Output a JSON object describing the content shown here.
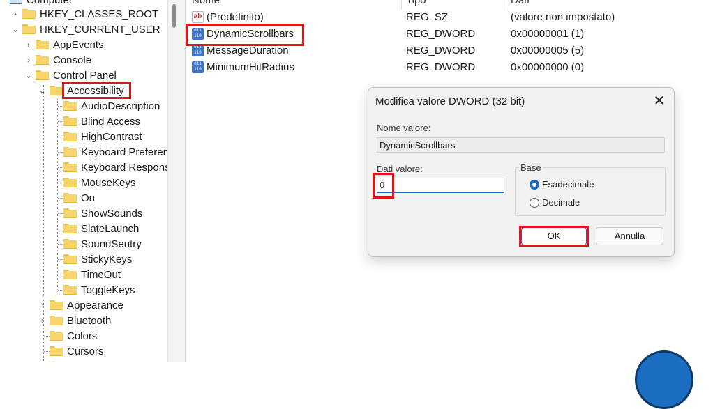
{
  "tree": {
    "items": [
      {
        "label": "Computer",
        "expander": "chevron-down"
      },
      {
        "label": "HKEY_CLASSES_ROOT",
        "expander": "chevron-right"
      },
      {
        "label": "HKEY_CURRENT_USER",
        "expander": "chevron-down"
      },
      {
        "label": "AppEvents",
        "expander": "chevron-right"
      },
      {
        "label": "Console",
        "expander": "chevron-right"
      },
      {
        "label": "Control Panel",
        "expander": "chevron-down"
      },
      {
        "label": "Accessibility",
        "expander": "chevron-down",
        "selected": true
      },
      {
        "label": "AudioDescription",
        "expander": "none"
      },
      {
        "label": "Blind Access",
        "expander": "none"
      },
      {
        "label": "HighContrast",
        "expander": "none"
      },
      {
        "label": "Keyboard Preference",
        "expander": "none"
      },
      {
        "label": "Keyboard Response",
        "expander": "none"
      },
      {
        "label": "MouseKeys",
        "expander": "none"
      },
      {
        "label": "On",
        "expander": "none"
      },
      {
        "label": "ShowSounds",
        "expander": "none"
      },
      {
        "label": "SlateLaunch",
        "expander": "none"
      },
      {
        "label": "SoundSentry",
        "expander": "none"
      },
      {
        "label": "StickyKeys",
        "expander": "none"
      },
      {
        "label": "TimeOut",
        "expander": "none"
      },
      {
        "label": "ToggleKeys",
        "expander": "none"
      },
      {
        "label": "Appearance",
        "expander": "chevron-right"
      },
      {
        "label": "Bluetooth",
        "expander": "chevron-right"
      },
      {
        "label": "Colors",
        "expander": "none"
      },
      {
        "label": "Cursors",
        "expander": "none"
      }
    ]
  },
  "values_pane": {
    "columns": [
      "Nome",
      "Tipo",
      "Dati"
    ],
    "rows": [
      {
        "name": "(Predefinito)",
        "type": "REG_SZ",
        "data": "(valore non impostato)",
        "icon": "string-value-icon"
      },
      {
        "name": "DynamicScrollbars",
        "type": "REG_DWORD",
        "data": "0x00000001 (1)",
        "icon": "binary-value-icon",
        "highlighted": true
      },
      {
        "name": "MessageDuration",
        "type": "REG_DWORD",
        "data": "0x00000005 (5)",
        "icon": "binary-value-icon"
      },
      {
        "name": "MinimumHitRadius",
        "type": "REG_DWORD",
        "data": "0x00000000 (0)",
        "icon": "binary-value-icon"
      }
    ]
  },
  "dialog": {
    "title": "Modifica valore DWORD (32 bit)",
    "close_glyph": "✕",
    "name_label": "Nome valore:",
    "name_value": "DynamicScrollbars",
    "data_label": "Dati valore:",
    "data_value": "0",
    "base_label": "Base",
    "base_options": [
      {
        "label": "Esadecimale",
        "selected": true
      },
      {
        "label": "Decimale",
        "selected": false
      }
    ],
    "ok_label": "OK",
    "cancel_label": "Annulla"
  },
  "colors": {
    "highlight_box": "#e0161b",
    "accent": "#1a65c0",
    "folder": "#f7d56b"
  }
}
